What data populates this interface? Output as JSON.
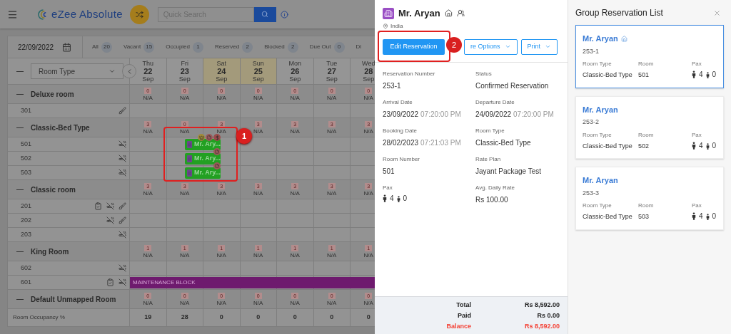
{
  "topbar": {
    "app_name": "eZee Absolute",
    "search_placeholder": "Quick Search"
  },
  "filter": {
    "date": "22/09/2022",
    "counts": [
      {
        "label": "All",
        "count": "20"
      },
      {
        "label": "Vacant",
        "count": "15"
      },
      {
        "label": "Occupied",
        "count": "1"
      },
      {
        "label": "Reserved",
        "count": "2"
      },
      {
        "label": "Blocked",
        "count": "2"
      },
      {
        "label": "Due Out",
        "count": "0"
      },
      {
        "label": "Di"
      }
    ]
  },
  "grid": {
    "room_type_select": "Room Type",
    "days": [
      {
        "dow": "Thu",
        "day": "22",
        "month": "Sep",
        "weekend": false
      },
      {
        "dow": "Fri",
        "day": "23",
        "month": "Sep",
        "weekend": false
      },
      {
        "dow": "Sat",
        "day": "24",
        "month": "Sep",
        "weekend": true
      },
      {
        "dow": "Sun",
        "day": "25",
        "month": "Sep",
        "weekend": true
      },
      {
        "dow": "Mon",
        "day": "26",
        "month": "Sep",
        "weekend": false
      },
      {
        "dow": "Tue",
        "day": "27",
        "month": "Sep",
        "weekend": false
      },
      {
        "dow": "Wed",
        "day": "28",
        "month": "Sep",
        "weekend": false
      }
    ],
    "groups": [
      {
        "name": "Deluxe room",
        "availability": [
          {
            "count": "0",
            "rate": "N/A"
          },
          {
            "count": "0",
            "rate": "N/A"
          },
          {
            "count": "0",
            "rate": "N/A"
          },
          {
            "count": "0",
            "rate": "N/A"
          },
          {
            "count": "0",
            "rate": "N/A"
          },
          {
            "count": "0",
            "rate": "N/A"
          },
          {
            "count": "0",
            "rate": "N/A"
          }
        ],
        "rooms": [
          {
            "number": "301",
            "inspected": false,
            "non_smoking": false,
            "dirty": true
          }
        ]
      },
      {
        "name": "Classic-Bed Type",
        "availability": [
          {
            "count": "3",
            "rate": "N/A"
          },
          {
            "count": "0",
            "rate": "N/A"
          },
          {
            "count": "3",
            "rate": "N/A"
          },
          {
            "count": "3",
            "rate": "N/A"
          },
          {
            "count": "3",
            "rate": "N/A"
          },
          {
            "count": "3",
            "rate": "N/A"
          },
          {
            "count": "3",
            "rate": "N/A"
          }
        ],
        "rooms": [
          {
            "number": "501",
            "inspected": false,
            "non_smoking": true,
            "dirty": false,
            "booking": {
              "guest": "Mr. Ary...",
              "vip": true,
              "note": true,
              "payment": true
            }
          },
          {
            "number": "502",
            "inspected": false,
            "non_smoking": true,
            "dirty": false,
            "booking": {
              "guest": "Mr. Ary...",
              "vip": false,
              "note": true,
              "payment": false
            }
          },
          {
            "number": "503",
            "inspected": false,
            "non_smoking": true,
            "dirty": false,
            "booking": {
              "guest": "Mr. Ary...",
              "vip": false,
              "note": true,
              "payment": false
            }
          }
        ]
      },
      {
        "name": "Classic room",
        "availability": [
          {
            "count": "3",
            "rate": "N/A"
          },
          {
            "count": "3",
            "rate": "N/A"
          },
          {
            "count": "3",
            "rate": "N/A"
          },
          {
            "count": "3",
            "rate": "N/A"
          },
          {
            "count": "3",
            "rate": "N/A"
          },
          {
            "count": "3",
            "rate": "N/A"
          },
          {
            "count": "3",
            "rate": "N/A"
          }
        ],
        "rooms": [
          {
            "number": "201",
            "inspected": true,
            "non_smoking": true,
            "dirty": true
          },
          {
            "number": "202",
            "inspected": false,
            "non_smoking": true,
            "dirty": true
          },
          {
            "number": "203",
            "inspected": false,
            "non_smoking": true,
            "dirty": false
          }
        ]
      },
      {
        "name": "King Room",
        "availability": [
          {
            "count": "1",
            "rate": "N/A"
          },
          {
            "count": "1",
            "rate": "N/A"
          },
          {
            "count": "1",
            "rate": "N/A"
          },
          {
            "count": "1",
            "rate": "N/A"
          },
          {
            "count": "1",
            "rate": "N/A"
          },
          {
            "count": "1",
            "rate": "N/A"
          },
          {
            "count": "1",
            "rate": "N/A"
          }
        ],
        "rooms": [
          {
            "number": "602",
            "inspected": false,
            "non_smoking": true,
            "dirty": false
          },
          {
            "number": "601",
            "inspected": true,
            "non_smoking": true,
            "dirty": false,
            "block": {
              "label": "MAINTENANCE BLOCK"
            }
          }
        ]
      },
      {
        "name": "Default Unmapped Room",
        "availability": [
          {
            "count": "0",
            "rate": "N/A"
          },
          {
            "count": "0",
            "rate": "N/A"
          },
          {
            "count": "0",
            "rate": "N/A"
          },
          {
            "count": "0",
            "rate": "N/A"
          },
          {
            "count": "0",
            "rate": "N/A"
          },
          {
            "count": "0",
            "rate": "N/A"
          },
          {
            "count": "0",
            "rate": "N/A"
          }
        ]
      }
    ],
    "occupancy": {
      "label": "Room Occupancy %",
      "values": [
        "19",
        "28",
        "0",
        "0",
        "0",
        "0",
        "0"
      ]
    }
  },
  "annotations": [
    {
      "label": "1"
    },
    {
      "label": "2"
    }
  ],
  "details": {
    "guest": "Mr. Aryan",
    "country": "India",
    "buttons": [
      {
        "label": "Edit Reservation",
        "kind": "primary"
      },
      {
        "label": "re Options",
        "kind": "dropdown"
      },
      {
        "label": "Print",
        "kind": "dropdown"
      }
    ],
    "fields": [
      {
        "kind": "text",
        "label": "Reservation Number",
        "value": "253-1"
      },
      {
        "kind": "text",
        "label": "Status",
        "value": "Confirmed Reservation"
      },
      {
        "kind": "datetime",
        "label": "Arrival Date",
        "value": "23/09/2022",
        "time": "07:20:00 PM"
      },
      {
        "kind": "datetime",
        "label": "Departure Date",
        "value": "24/09/2022",
        "time": "07:20:00 PM"
      },
      {
        "kind": "datetime",
        "label": "Booking Date",
        "value": "28/02/2023",
        "time": "07:21:03 PM"
      },
      {
        "kind": "text",
        "label": "Room Type",
        "value": "Classic-Bed Type"
      },
      {
        "kind": "text",
        "label": "Room Number",
        "value": "501"
      },
      {
        "kind": "text",
        "label": "Rate Plan",
        "value": "Jayant Package Test"
      },
      {
        "kind": "pax",
        "label": "Pax",
        "adults": "4",
        "children": "0"
      },
      {
        "kind": "text",
        "label": "Avg. Daily Rate",
        "value": "Rs 100.00"
      }
    ],
    "totals": [
      {
        "label": "Total",
        "value": "Rs 8,592.00",
        "kind": "normal"
      },
      {
        "label": "Paid",
        "value": "Rs 0.00",
        "kind": "normal"
      },
      {
        "label": "Balance",
        "value": "Rs 8,592.00",
        "kind": "due"
      }
    ]
  },
  "group_list": {
    "title": "Group Reservation List",
    "cards": [
      {
        "guest": "Mr. Aryan",
        "number": "253-1",
        "master": true,
        "selected": true,
        "room_type_label": "Room Type",
        "room_type": "Classic-Bed Type",
        "room_label": "Room",
        "room": "501",
        "pax_label": "Pax",
        "adults": "4",
        "children": "0"
      },
      {
        "guest": "Mr. Aryan",
        "number": "253-2",
        "master": false,
        "selected": false,
        "room_type_label": "Room Type",
        "room_type": "Classic-Bed Type",
        "room_label": "Room",
        "room": "502",
        "pax_label": "Pax",
        "adults": "4",
        "children": "0"
      },
      {
        "guest": "Mr. Aryan",
        "number": "253-3",
        "master": false,
        "selected": false,
        "room_type_label": "Room Type",
        "room_type": "Classic-Bed Type",
        "room_label": "Room",
        "room": "503",
        "pax_label": "Pax",
        "adults": "4",
        "children": "0"
      }
    ]
  }
}
